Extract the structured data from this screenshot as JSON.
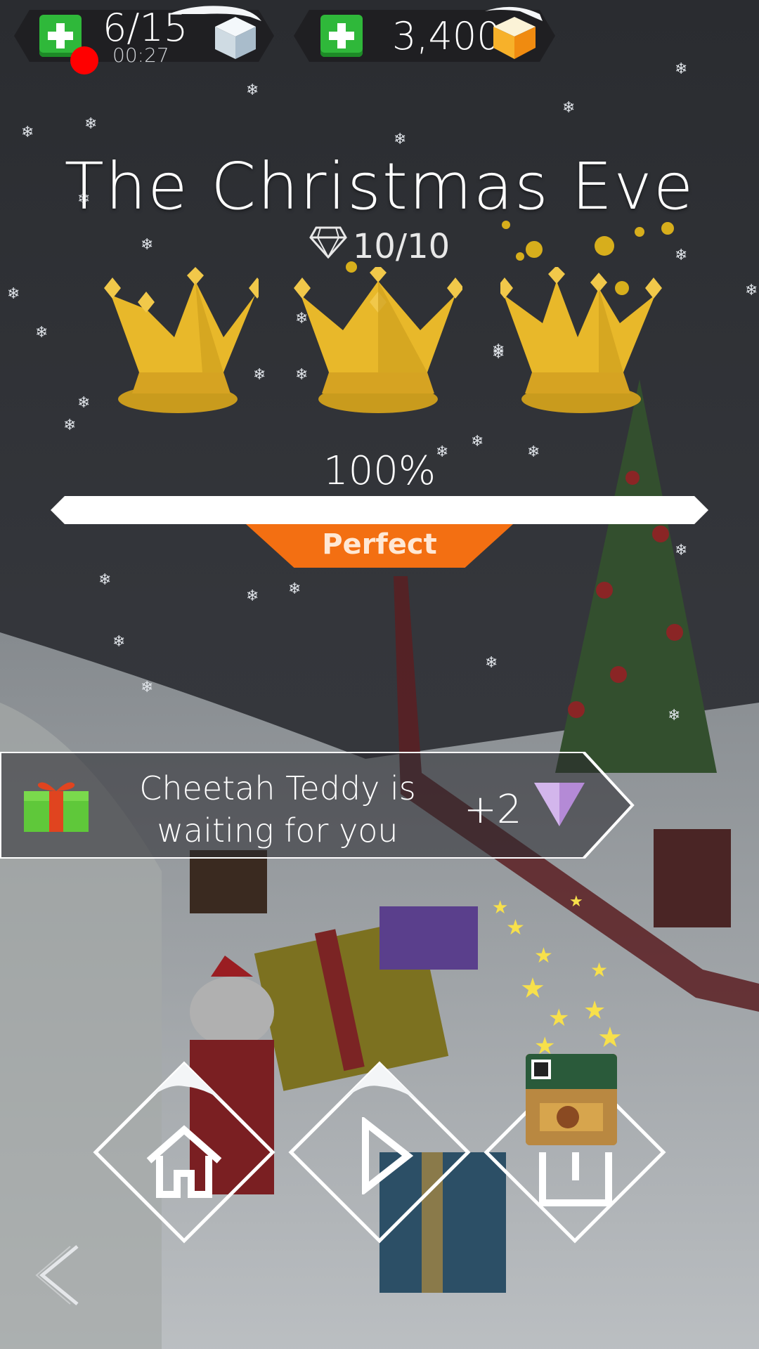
{
  "hud": {
    "lives": "6/15",
    "timer": "00:27",
    "currency": "3,400"
  },
  "level": {
    "title": "The Christmas Eve",
    "gems": "10/10",
    "crowns_earned": 3,
    "crowns_total": 3,
    "progress_label": "100%",
    "progress_value": 1.0,
    "rating": "Perfect"
  },
  "reward": {
    "message_line1": "Cheetah Teddy is",
    "message_line2": "waiting for you",
    "amount": "+2"
  },
  "icons": {
    "add_lives": "plus-icon",
    "lives": "ice-cube-icon",
    "add_currency": "plus-icon",
    "currency": "gold-cube-icon",
    "gems": "diamond-icon",
    "gift": "gift-icon",
    "reward_gem": "purple-triangle-gem-icon",
    "home": "home-icon",
    "replay": "play-icon",
    "share": "share-icon",
    "back": "chevron-left-icon",
    "recording": "record-dot-icon"
  },
  "colors": {
    "accent_orange": "#f36f12",
    "crown_gold": "#e8b82a",
    "plus_green": "#2fb83a",
    "gem_purple": "#b48ad6"
  }
}
